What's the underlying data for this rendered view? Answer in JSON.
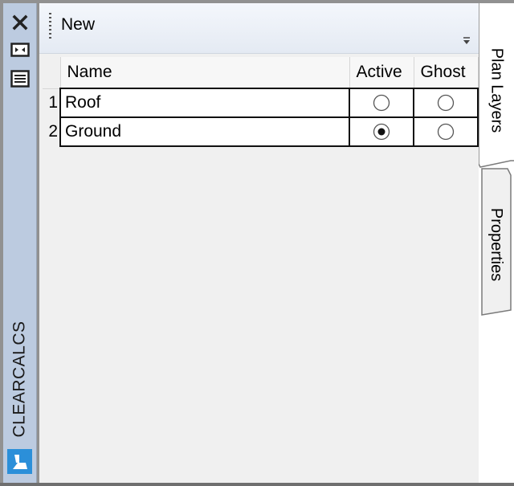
{
  "sidebar": {
    "app_label": "CLEARCALCS",
    "buttons": [
      {
        "name": "close-icon"
      },
      {
        "name": "dock-toggle-icon"
      },
      {
        "name": "menu-icon"
      }
    ],
    "logo": "app-logo-icon"
  },
  "toolbar": {
    "new_label": "New"
  },
  "grid": {
    "columns": [
      "Name",
      "Active",
      "Ghost"
    ],
    "rows": [
      {
        "index": "1",
        "name": "Roof",
        "active": false,
        "ghost": false
      },
      {
        "index": "2",
        "name": "Ground",
        "active": true,
        "ghost": false
      }
    ]
  },
  "tabs": {
    "items": [
      {
        "label": "Plan Layers",
        "selected": true
      },
      {
        "label": "Properties",
        "selected": false
      }
    ]
  },
  "colors": {
    "sidebar_bg": "#bccbe0",
    "toolbar_bg": "#e4eaf3",
    "logo_bg": "#2b8fd9"
  }
}
